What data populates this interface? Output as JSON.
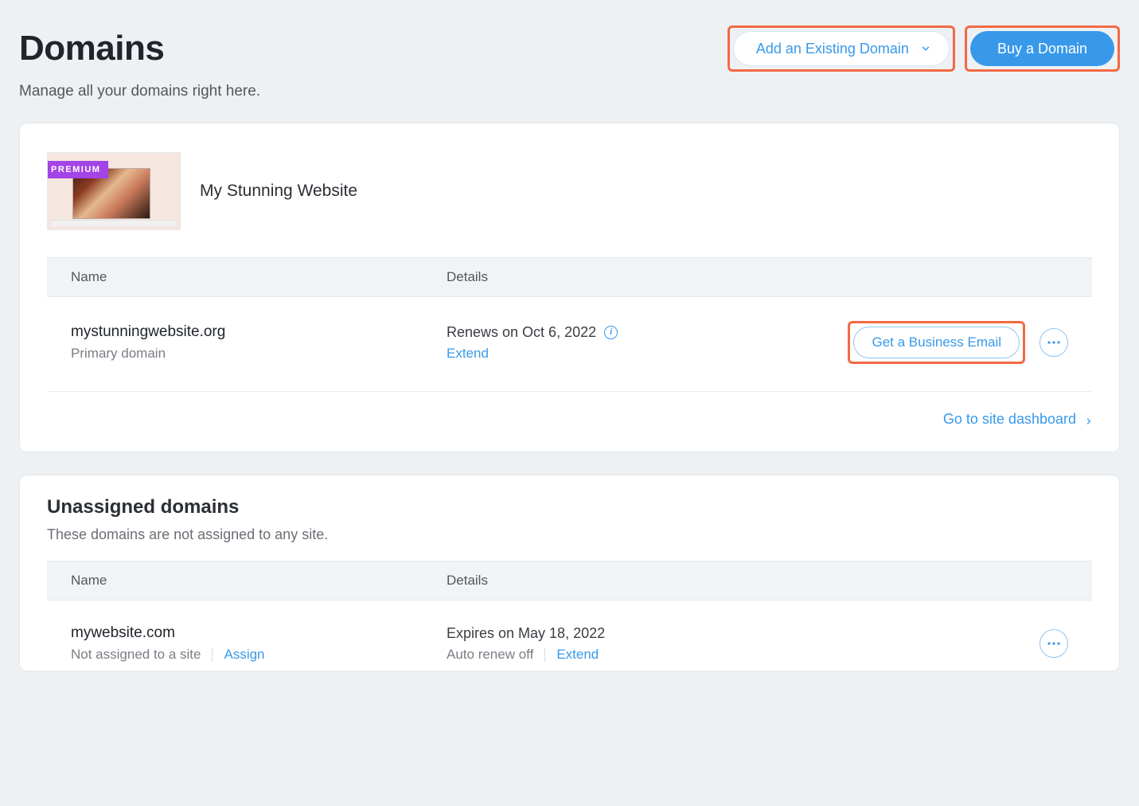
{
  "page": {
    "title": "Domains",
    "subtitle": "Manage all your domains right here."
  },
  "header": {
    "add_existing_label": "Add an Existing Domain",
    "buy_label": "Buy a Domain"
  },
  "site": {
    "badge": "PREMIUM",
    "name": "My Stunning Website",
    "columns": {
      "name": "Name",
      "details": "Details"
    },
    "domain": {
      "name": "mystunningwebsite.org",
      "sub": "Primary domain",
      "renews": "Renews on Oct 6, 2022",
      "extend": "Extend",
      "cta": "Get a Business Email"
    },
    "footer_link": "Go to site dashboard"
  },
  "unassigned": {
    "title": "Unassigned domains",
    "subtitle": "These domains are not assigned to any site.",
    "columns": {
      "name": "Name",
      "details": "Details"
    },
    "domain": {
      "name": "mywebsite.com",
      "sub": "Not assigned to a site",
      "assign": "Assign",
      "expires": "Expires on May 18, 2022",
      "auto_renew": "Auto renew off",
      "extend": "Extend"
    }
  }
}
